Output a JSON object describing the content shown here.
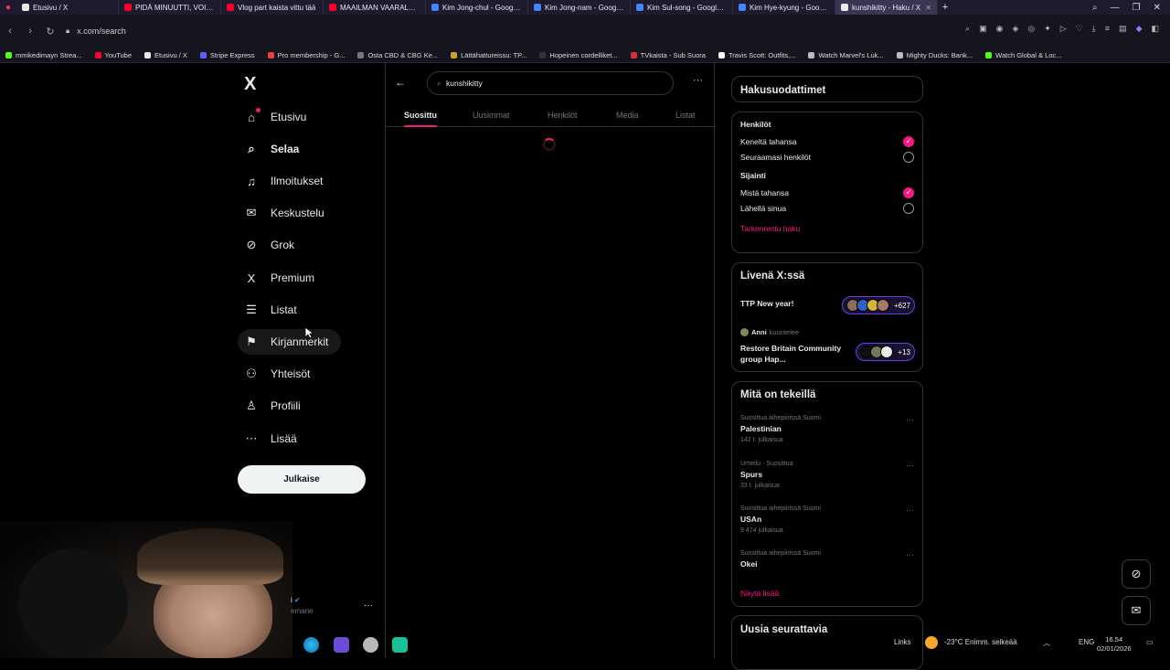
{
  "browser": {
    "tabs": [
      {
        "label": "Etusivu / X",
        "color": "#e7e9ea"
      },
      {
        "label": "PIDÄ MINUUTTI, VOITA 20",
        "color": "#ff0033"
      },
      {
        "label": "Vlog part kaista vittu tää",
        "color": "#ff0033"
      },
      {
        "label": "MAAILMAN VAARALLISIN",
        "color": "#ff0033"
      },
      {
        "label": "Kim Jong-chul - Google-h",
        "color": "#4285f4"
      },
      {
        "label": "Kim Jong-nam - Google-h",
        "color": "#4285f4"
      },
      {
        "label": "Kim Sul-song - Google-h",
        "color": "#4285f4"
      },
      {
        "label": "Kim Hye-kyung - Google",
        "color": "#4285f4"
      },
      {
        "label": "kunshikitty - Haku / X",
        "color": "#e7e9ea",
        "active": true
      }
    ],
    "url": "x.com/search",
    "bookmarks": [
      {
        "label": "mmikedimayn Strea...",
        "color": "#53fc18"
      },
      {
        "label": "YouTube",
        "color": "#ff0033"
      },
      {
        "label": "Etusivu / X",
        "color": "#e7e9ea"
      },
      {
        "label": "Stripe Express",
        "color": "#635bff"
      },
      {
        "label": "Pro membership - G...",
        "color": "#ea4335"
      },
      {
        "label": "Osta CBD & CBG Ke...",
        "color": "#777777"
      },
      {
        "label": "Lättähattureissu: TP...",
        "color": "#c9a227"
      },
      {
        "label": "Hopeinen cordelliket...",
        "color": "#333333"
      },
      {
        "label": "TVkaista - Sub Suora",
        "color": "#d6303a"
      },
      {
        "label": "Travis Scott: Outfits,...",
        "color": "#ffffff"
      },
      {
        "label": "Watch Marvel's Luk...",
        "color": "#bbbbbb"
      },
      {
        "label": "Mighty Ducks: Bank...",
        "color": "#bbbbbb"
      },
      {
        "label": "Watch Global & Loc...",
        "color": "#53fc18"
      }
    ]
  },
  "nav": {
    "logo": "X",
    "items": [
      {
        "label": "Etusivu",
        "icon": "home-icon"
      },
      {
        "label": "Selaa",
        "icon": "search-icon",
        "bold": true
      },
      {
        "label": "Ilmoitukset",
        "icon": "bell-icon"
      },
      {
        "label": "Keskustelu",
        "icon": "mail-icon"
      },
      {
        "label": "Grok",
        "icon": "grok-icon"
      },
      {
        "label": "Premium",
        "icon": "x-icon"
      },
      {
        "label": "Listat",
        "icon": "list-icon"
      },
      {
        "label": "Kirjanmerkit",
        "icon": "bookmark-icon"
      },
      {
        "label": "Yhteisöt",
        "icon": "communities-icon"
      },
      {
        "label": "Profiili",
        "icon": "profile-icon"
      },
      {
        "label": "Lisää",
        "icon": "more-icon"
      }
    ],
    "post_label": "Julkaise",
    "account_name": "i",
    "account_handle": "emane"
  },
  "search": {
    "query": "kunshikitty",
    "tabs": [
      "Suosittu",
      "Uusimmat",
      "Henkilöt",
      "Media",
      "Listat"
    ],
    "active_tab": "Suosittu"
  },
  "filters": {
    "title": "Hakusuodattimet",
    "people_heading": "Henkilöt",
    "people_options": [
      "Keneltä tahansa",
      "Seuraamasi henkilöt"
    ],
    "location_heading": "Sijainti",
    "location_options": [
      "Mistä tahansa",
      "Lähellä sinua"
    ],
    "advanced": "Tarkennettu haku"
  },
  "live": {
    "title": "Livenä X:ssä",
    "spaces": [
      {
        "title": "TTP New year!",
        "count": "+627"
      },
      {
        "host": "Anni",
        "host_action": "kuuntelee",
        "title": "Restore Britain Community group Hap...",
        "count": "+13"
      }
    ]
  },
  "trends": {
    "title": "Mitä on tekeillä",
    "items": [
      {
        "context": "Suosittua aihepiirissä Suomi",
        "name": "Palestinian",
        "count": "142 t. julkaisua"
      },
      {
        "context": "Urheilu · Suosittua",
        "name": "Spurs",
        "count": "33 t. julkaisua"
      },
      {
        "context": "Suosittua aihepiirissä Suomi",
        "name": "USAn",
        "count": "9 474 julkaisua"
      },
      {
        "context": "Suosittua aihepiirissä Suomi",
        "name": "Okei",
        "count": ""
      }
    ],
    "show_more": "Näytä lisää"
  },
  "follow": {
    "title": "Uusia seurattavia"
  },
  "taskbar": {
    "links": "Links",
    "weather": "-23°C  Enimm. selkeää",
    "lang": "ENG",
    "time": "16.54",
    "date": "02/01/2026"
  },
  "colors": {
    "accent": "#f91880",
    "background": "#000000",
    "border": "#2f3336"
  }
}
